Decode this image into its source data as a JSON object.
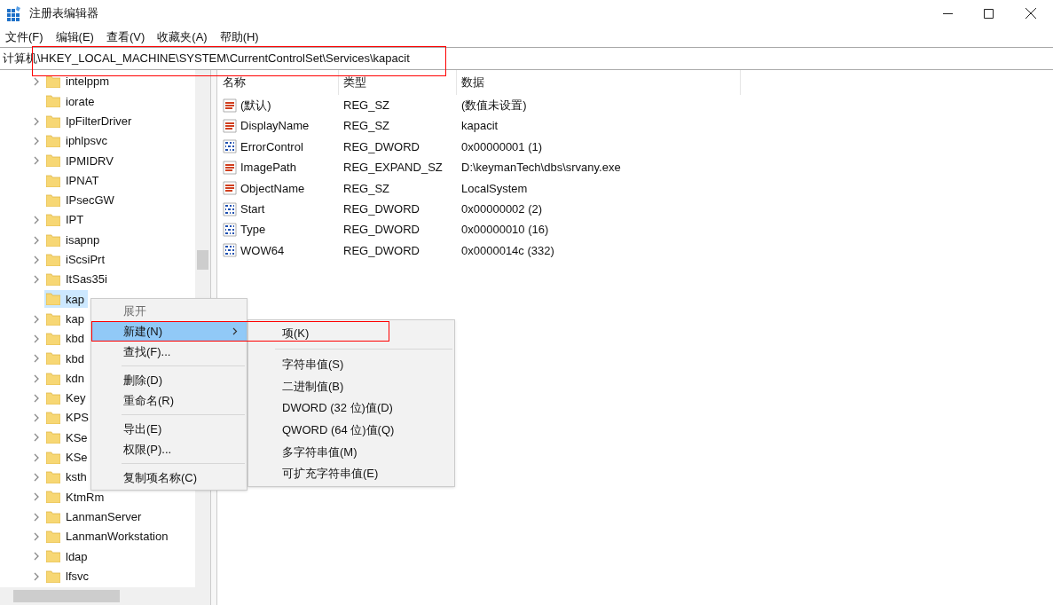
{
  "window": {
    "title": "注册表编辑器"
  },
  "menu_bar": [
    "文件(F)",
    "编辑(E)",
    "查看(V)",
    "收藏夹(A)",
    "帮助(H)"
  ],
  "address_bar": {
    "value": "计算机\\HKEY_LOCAL_MACHINE\\SYSTEM\\CurrentControlSet\\Services\\kapacit",
    "annotated": true
  },
  "tree": [
    {
      "label": "intelppm",
      "expandable": true,
      "selected": false
    },
    {
      "label": "iorate",
      "expandable": false,
      "selected": false
    },
    {
      "label": "IpFilterDriver",
      "expandable": true,
      "selected": false
    },
    {
      "label": "iphlpsvc",
      "expandable": true,
      "selected": false
    },
    {
      "label": "IPMIDRV",
      "expandable": true,
      "selected": false
    },
    {
      "label": "IPNAT",
      "expandable": false,
      "selected": false
    },
    {
      "label": "IPsecGW",
      "expandable": false,
      "selected": false
    },
    {
      "label": "IPT",
      "expandable": true,
      "selected": false
    },
    {
      "label": "isapnp",
      "expandable": true,
      "selected": false
    },
    {
      "label": "iScsiPrt",
      "expandable": true,
      "selected": false
    },
    {
      "label": "ItSas35i",
      "expandable": true,
      "selected": false
    },
    {
      "label": "kap",
      "expandable": false,
      "selected": true
    },
    {
      "label": "kap",
      "expandable": true,
      "selected": false
    },
    {
      "label": "kbd",
      "expandable": true,
      "selected": false
    },
    {
      "label": "kbd",
      "expandable": true,
      "selected": false
    },
    {
      "label": "kdn",
      "expandable": true,
      "selected": false
    },
    {
      "label": "Key",
      "expandable": true,
      "selected": false
    },
    {
      "label": "KPS",
      "expandable": true,
      "selected": false
    },
    {
      "label": "KSe",
      "expandable": true,
      "selected": false
    },
    {
      "label": "KSe",
      "expandable": true,
      "selected": false
    },
    {
      "label": "ksth",
      "expandable": true,
      "selected": false
    },
    {
      "label": "KtmRm",
      "expandable": true,
      "selected": false
    },
    {
      "label": "LanmanServer",
      "expandable": true,
      "selected": false
    },
    {
      "label": "LanmanWorkstation",
      "expandable": true,
      "selected": false
    },
    {
      "label": "ldap",
      "expandable": true,
      "selected": false
    },
    {
      "label": "lfsvc",
      "expandable": true,
      "selected": false
    }
  ],
  "values": {
    "columns": [
      "名称",
      "类型",
      "数据"
    ],
    "rows": [
      {
        "kind": "string",
        "name": "(默认)",
        "type": "REG_SZ",
        "data": "(数值未设置)"
      },
      {
        "kind": "string",
        "name": "DisplayName",
        "type": "REG_SZ",
        "data": "kapacit"
      },
      {
        "kind": "binary",
        "name": "ErrorControl",
        "type": "REG_DWORD",
        "data": "0x00000001 (1)"
      },
      {
        "kind": "string",
        "name": "ImagePath",
        "type": "REG_EXPAND_SZ",
        "data": "D:\\keymanTech\\dbs\\srvany.exe"
      },
      {
        "kind": "string",
        "name": "ObjectName",
        "type": "REG_SZ",
        "data": "LocalSystem"
      },
      {
        "kind": "binary",
        "name": "Start",
        "type": "REG_DWORD",
        "data": "0x00000002 (2)"
      },
      {
        "kind": "binary",
        "name": "Type",
        "type": "REG_DWORD",
        "data": "0x00000010 (16)"
      },
      {
        "kind": "binary",
        "name": "WOW64",
        "type": "REG_DWORD",
        "data": "0x0000014c (332)"
      }
    ]
  },
  "context_menu": {
    "items": [
      {
        "kind": "item",
        "label": "展开",
        "disabled": true,
        "selected": false,
        "submenu": false,
        "annotated": false
      },
      {
        "kind": "item",
        "label": "新建(N)",
        "disabled": false,
        "selected": true,
        "submenu": true,
        "annotated": true
      },
      {
        "kind": "item",
        "label": "查找(F)...",
        "disabled": false,
        "selected": false,
        "submenu": false,
        "annotated": false
      },
      {
        "kind": "separator"
      },
      {
        "kind": "item",
        "label": "删除(D)",
        "disabled": false,
        "selected": false,
        "submenu": false,
        "annotated": false
      },
      {
        "kind": "item",
        "label": "重命名(R)",
        "disabled": false,
        "selected": false,
        "submenu": false,
        "annotated": false
      },
      {
        "kind": "separator"
      },
      {
        "kind": "item",
        "label": "导出(E)",
        "disabled": false,
        "selected": false,
        "submenu": false,
        "annotated": false
      },
      {
        "kind": "item",
        "label": "权限(P)...",
        "disabled": false,
        "selected": false,
        "submenu": false,
        "annotated": false
      },
      {
        "kind": "separator"
      },
      {
        "kind": "item",
        "label": "复制项名称(C)",
        "disabled": false,
        "selected": false,
        "submenu": false,
        "annotated": false
      }
    ]
  },
  "submenu": {
    "items": [
      {
        "kind": "item",
        "label": "项(K)"
      },
      {
        "kind": "separator"
      },
      {
        "kind": "item",
        "label": "字符串值(S)"
      },
      {
        "kind": "item",
        "label": "二进制值(B)"
      },
      {
        "kind": "item",
        "label": "DWORD (32 位)值(D)"
      },
      {
        "kind": "item",
        "label": "QWORD (64 位)值(Q)"
      },
      {
        "kind": "item",
        "label": "多字符串值(M)"
      },
      {
        "kind": "item",
        "label": "可扩充字符串值(E)"
      }
    ]
  }
}
